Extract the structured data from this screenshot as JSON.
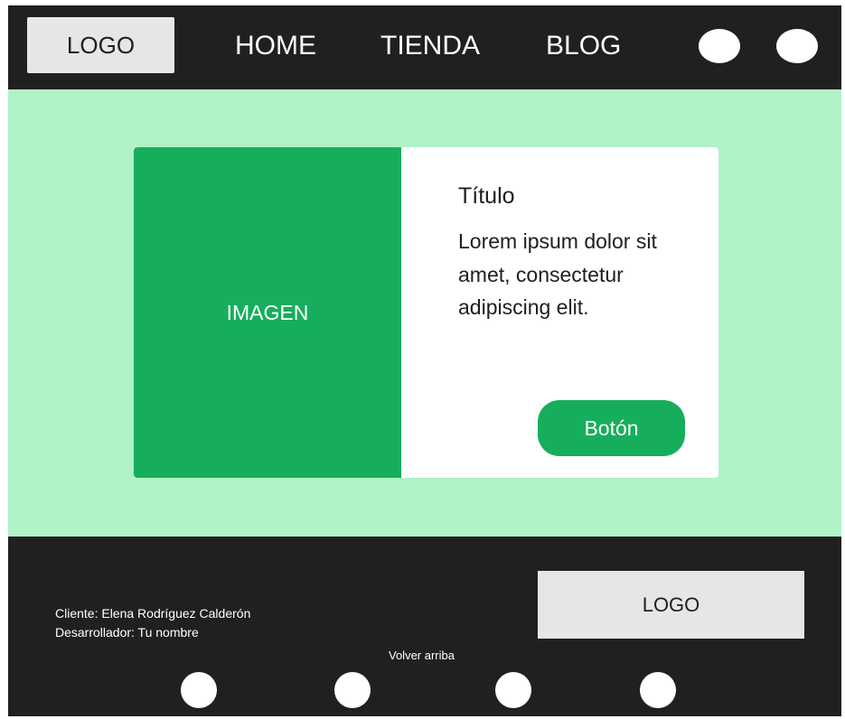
{
  "header": {
    "logo": "LOGO",
    "nav": [
      {
        "label": "HOME"
      },
      {
        "label": "TIENDA"
      },
      {
        "label": "BLOG"
      }
    ],
    "icons": [
      "circle-icon",
      "circle-icon"
    ]
  },
  "hero": {
    "image_label": "IMAGEN",
    "title": "Título",
    "text": "Lorem ipsum dolor sit amet, consectetur adipiscing elit.",
    "button_label": "Botón"
  },
  "footer": {
    "client": "Cliente: Elena Rodríguez Calderón",
    "developer": "Desarrollador: Tu nombre",
    "logo": "LOGO",
    "back_to_top": "Volver arriba",
    "icons": [
      "circle-icon",
      "circle-icon",
      "circle-icon",
      "circle-icon"
    ]
  },
  "colors": {
    "dark": "#202020",
    "mint": "#b1f2c8",
    "green": "#16ae5c",
    "light_gray": "#e6e6e6",
    "white": "#ffffff"
  }
}
